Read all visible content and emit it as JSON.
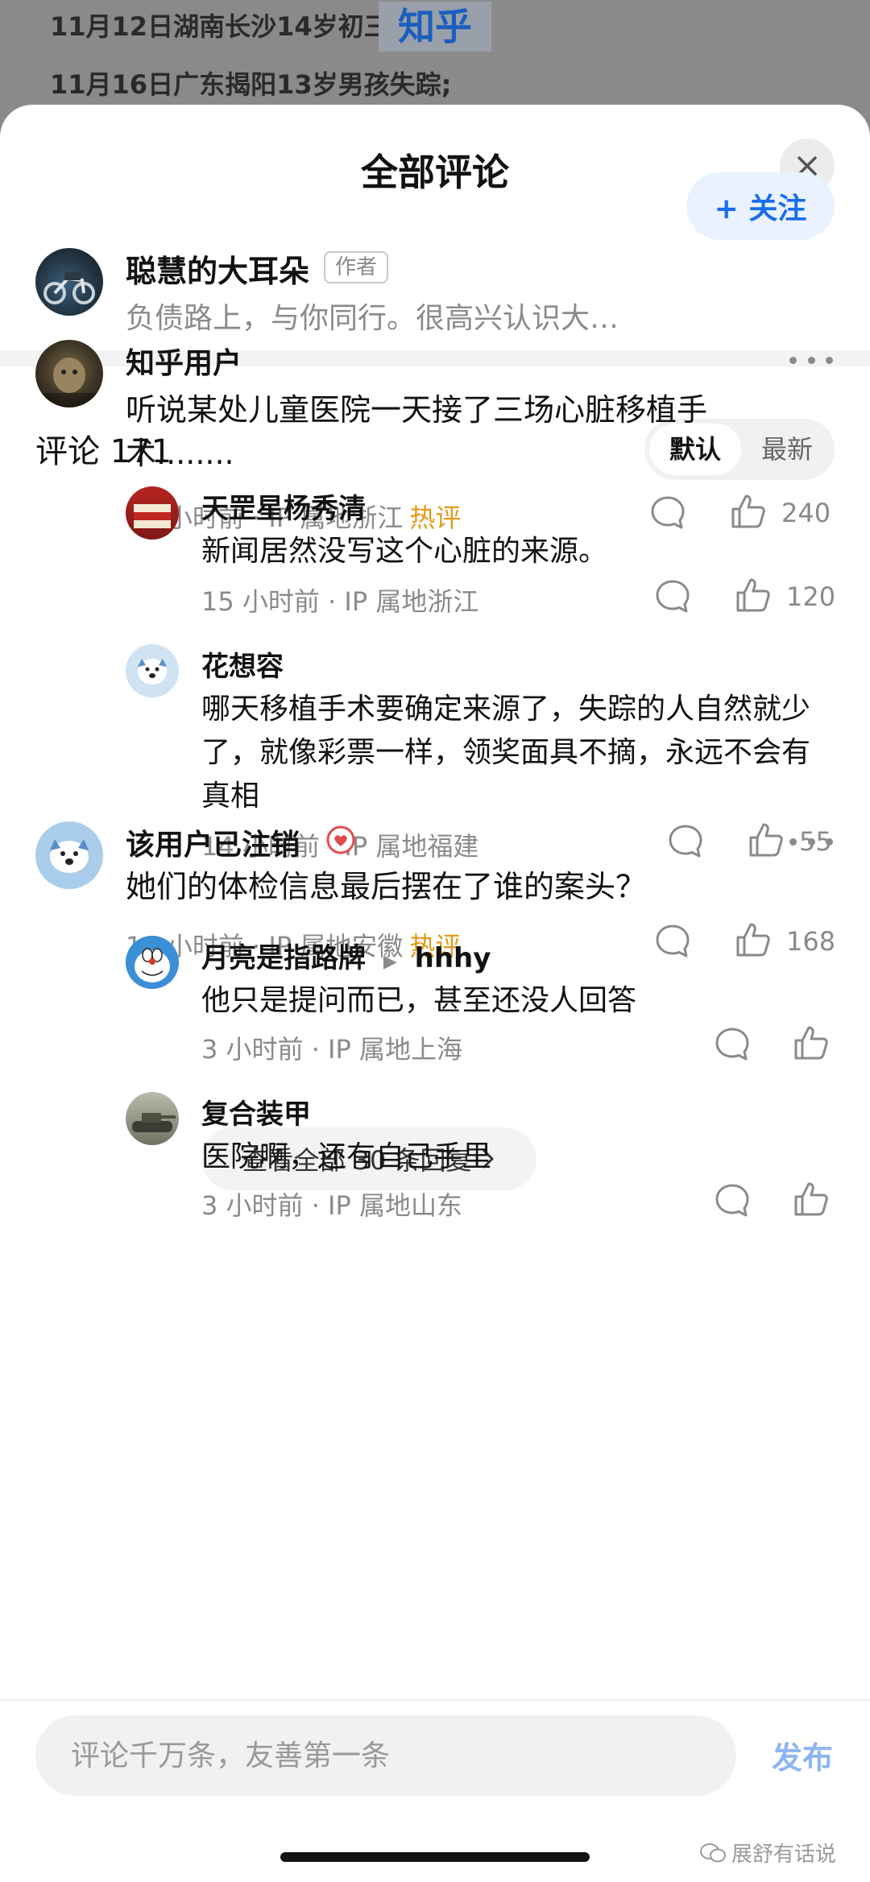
{
  "background": {
    "line1": "11月12日湖南长沙14岁初三",
    "line2": "11月16日广东揭阳13岁男孩失踪;",
    "logo": "知乎"
  },
  "sheet": {
    "title": "全部评论",
    "close_icon": "close-icon"
  },
  "author": {
    "name": "聪慧的大耳朵",
    "tag": "作者",
    "bio": "负债路上，与你同行。很高兴认识大…",
    "follow_label": "+ 关注"
  },
  "comments_header": {
    "title": "评论 171",
    "sort_default": "默认",
    "sort_latest": "最新"
  },
  "comments": [
    {
      "user": "知乎用户",
      "text": "听说某处儿童医院一天接了三场心脏移植手术........",
      "meta": "16 小时前 · IP 属地浙江",
      "hot": "热评",
      "likes": "240",
      "replies": [
        {
          "user": "天罡星杨秀清",
          "text": "新闻居然没写这个心脏的来源。",
          "meta": "15 小时前 · IP 属地浙江",
          "likes": "120"
        },
        {
          "user": "花想容",
          "text": "哪天移植手术要确定来源了，失踪的人自然就少了，就像彩票一样，领奖面具不摘，永远不会有真相",
          "meta": "14 小时前 · IP 属地福建",
          "likes": "55"
        }
      ],
      "view_all": "查看全部 30 条回复"
    },
    {
      "user": "该用户已注销",
      "text": "她们的体检信息最后摆在了谁的案头？",
      "meta": "16 小时前 · IP 属地安徽",
      "hot": "热评",
      "likes": "168",
      "replies": [
        {
          "user": "月亮是指路牌",
          "reply_to": "hhhy",
          "text": "他只是提问而已，甚至还没人回答",
          "meta": "3 小时前 · IP 属地上海",
          "likes": ""
        },
        {
          "user": "复合装甲",
          "text": "医院啊，还有自己手里",
          "meta": "3 小时前 · IP 属地山东",
          "likes": ""
        }
      ]
    }
  ],
  "input": {
    "placeholder": "评论千万条，友善第一条",
    "publish_label": "发布"
  },
  "watermark": "展舒有话说",
  "colors": {
    "accent": "#1a6ee8",
    "hot": "#e39a1b",
    "muted": "#8a8a8a"
  }
}
